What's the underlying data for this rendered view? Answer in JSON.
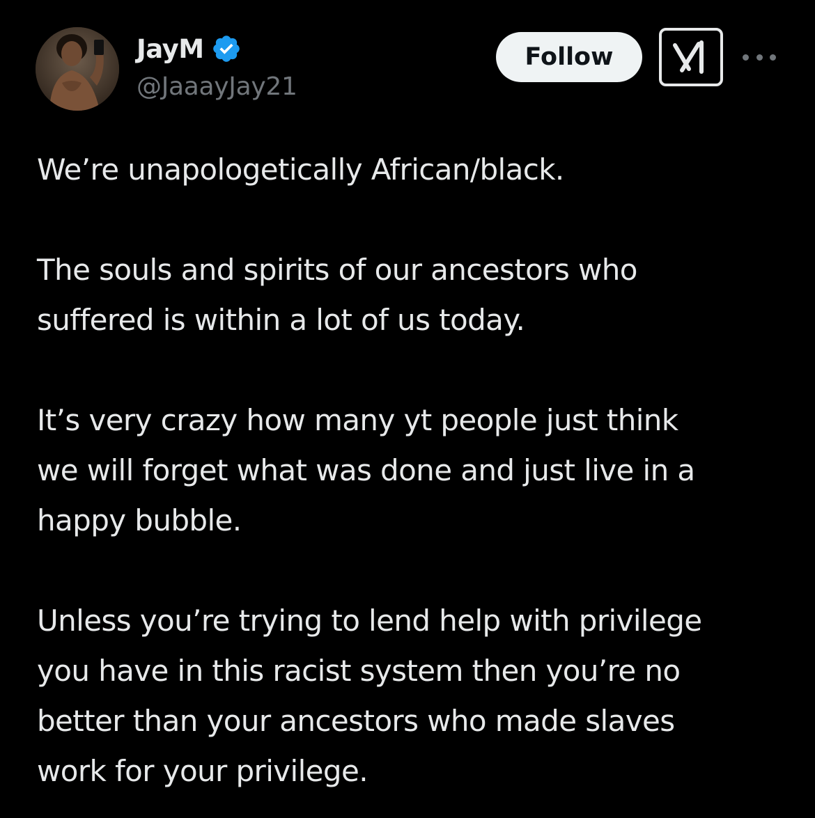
{
  "author": {
    "display_name": "JayM",
    "handle": "@JaaayJay21",
    "verified": true,
    "verified_color": "#1d9bf0"
  },
  "actions": {
    "follow_label": "Follow",
    "grok_icon": "grok-icon",
    "more_icon": "more-dots-icon"
  },
  "tweet": {
    "paragraphs": [
      [
        "We’re unapologetically African/black."
      ],
      [
        "The souls and spirits of our ancestors who",
        "suffered is within a lot of us today."
      ],
      [
        "It’s very crazy how many yt people just think",
        "we will forget what was done and just live in a",
        "happy bubble."
      ],
      [
        "Unless you’re trying to lend help with privilege",
        "you have in this racist system then you’re no",
        "better than your ancestors who made slaves",
        "work for your privilege."
      ]
    ]
  },
  "colors": {
    "background": "#000000",
    "text": "#e7e9ea",
    "secondary": "#71767b",
    "follow_bg": "#eff3f4",
    "follow_text": "#0f1419"
  }
}
